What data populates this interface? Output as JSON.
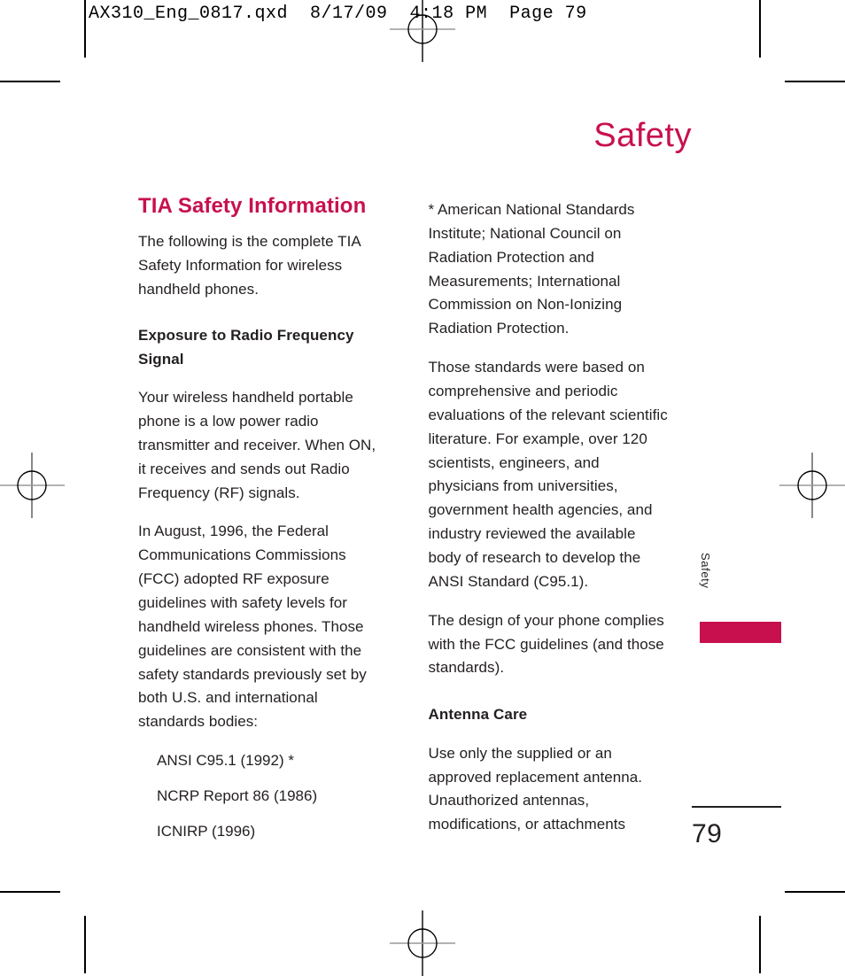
{
  "prepress": {
    "slug": "AX310_Eng_0817.qxd  8/17/09  4:18 PM  Page 79",
    "mark_color": "#000000"
  },
  "page": {
    "running_head": "Safety",
    "folio": "79",
    "thumb_tab_label": "Safety",
    "accent_color": "#c8104e",
    "text_color": "#231f20"
  },
  "left_column": {
    "section_title": "TIA Safety Information",
    "intro": "The following is the complete TIA Safety Information for wireless handheld phones.",
    "subheading": "Exposure to Radio Frequency Signal",
    "paragraph_1": "Your wireless handheld portable phone is a low power radio transmitter and receiver. When ON, it receives and sends out Radio Frequency (RF) signals.",
    "paragraph_2": "In August, 1996, the Federal Communications Commissions (FCC) adopted RF exposure guidelines with safety levels for handheld wireless phones. Those guidelines are consistent with the safety standards previously set by both U.S. and international standards bodies:",
    "standards_list": [
      "ANSI C95.1  (1992) *",
      "NCRP Report 86 (1986)",
      "ICNIRP (1996)"
    ]
  },
  "right_column": {
    "footnote": "* American National Standards Institute; National Council on Radiation Protection and Measurements; International Commission on Non-Ionizing Radiation Protection.",
    "paragraph_1": "Those standards were based on comprehensive and periodic evaluations of the relevant scientific literature. For example, over 120 scientists, engineers, and physicians from universities, government health agencies, and industry reviewed the available body of research to develop the ANSI Standard (C95.1).",
    "paragraph_2": "The design of your phone complies with the FCC guidelines (and those standards).",
    "subheading": "Antenna Care",
    "paragraph_3": "Use only the supplied or an approved replacement antenna. Unauthorized antennas, modifications, or attachments"
  }
}
